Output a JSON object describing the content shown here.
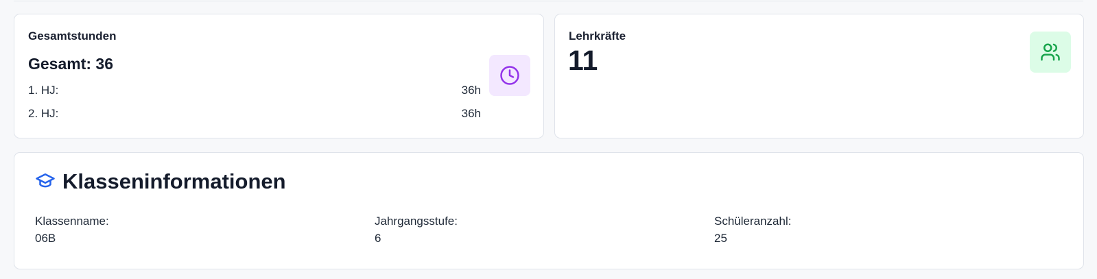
{
  "hours_card": {
    "title": "Gesamtstunden",
    "total": "Gesamt: 36",
    "rows": [
      {
        "label": "1. HJ:",
        "value": "36h"
      },
      {
        "label": "2. HJ:",
        "value": "36h"
      }
    ],
    "icon": "clock-icon",
    "icon_color": "#9333ea",
    "icon_bg": "#f3e8ff"
  },
  "teachers_card": {
    "title": "Lehrkräfte",
    "count": "11",
    "icon": "users-icon",
    "icon_color": "#16a34a",
    "icon_bg": "#dcfce7"
  },
  "class_info": {
    "title": "Klasseninformationen",
    "icon": "graduation-cap-icon",
    "icon_color": "#2563eb",
    "fields": [
      {
        "label": "Klassenname:",
        "value": "06B"
      },
      {
        "label": "Jahrgangsstufe:",
        "value": "6"
      },
      {
        "label": "Schüleranzahl:",
        "value": "25"
      }
    ]
  }
}
